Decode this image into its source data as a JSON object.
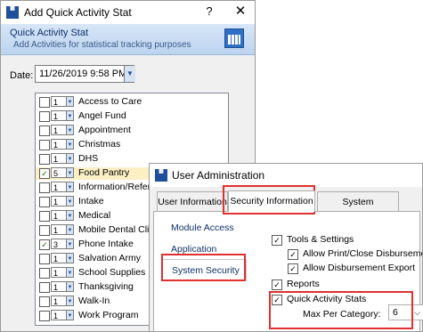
{
  "dialog1": {
    "title": "Add Quick Activity Stat",
    "help": "?",
    "close": "✕",
    "header_title": "Quick Activity Stat",
    "header_sub": "Add Activities for statistical tracking purposes",
    "date_label": "Date:",
    "date_value": "11/26/2019 9:58 PM",
    "dropdown_arrow": "▼",
    "items": [
      {
        "label": "Access to Care",
        "qty": "1",
        "checked": false
      },
      {
        "label": "Angel Fund",
        "qty": "1",
        "checked": false
      },
      {
        "label": "Appointment",
        "qty": "1",
        "checked": false
      },
      {
        "label": "Christmas",
        "qty": "1",
        "checked": false
      },
      {
        "label": "DHS",
        "qty": "1",
        "checked": false
      },
      {
        "label": "Food Pantry",
        "qty": "5",
        "checked": true,
        "highlight": true
      },
      {
        "label": "Information/Referral",
        "qty": "1",
        "checked": false
      },
      {
        "label": "Intake",
        "qty": "1",
        "checked": false
      },
      {
        "label": "Medical",
        "qty": "1",
        "checked": false
      },
      {
        "label": "Mobile Dental Clinic",
        "qty": "1",
        "checked": false
      },
      {
        "label": "Phone Intake",
        "qty": "3",
        "checked": true
      },
      {
        "label": "Salvation Army",
        "qty": "1",
        "checked": false
      },
      {
        "label": "School Supplies",
        "qty": "1",
        "checked": false
      },
      {
        "label": "Thanksgiving",
        "qty": "1",
        "checked": false
      },
      {
        "label": "Walk-In",
        "qty": "1",
        "checked": false
      },
      {
        "label": "Work Program",
        "qty": "1",
        "checked": false
      }
    ]
  },
  "dialog2": {
    "title": "User Administration",
    "tabs": [
      "User Information",
      "Security Information",
      "System Preferences"
    ],
    "side_items": [
      "Module Access",
      "Application Security",
      "System Security"
    ],
    "options": [
      {
        "label": "Tools & Settings",
        "checked": true
      },
      {
        "label": "Allow Print/Close Disbursements",
        "checked": true
      },
      {
        "label": "Allow Disbursement Export",
        "checked": true
      },
      {
        "label": "Reports",
        "checked": true
      },
      {
        "label": "Quick Activity Stats",
        "checked": true
      }
    ],
    "max_label": "Max Per Category:",
    "max_value": "6",
    "chevron": "⌵"
  },
  "colors": {
    "highlight_red": "#e03030",
    "accent": "#1f4e9a"
  }
}
